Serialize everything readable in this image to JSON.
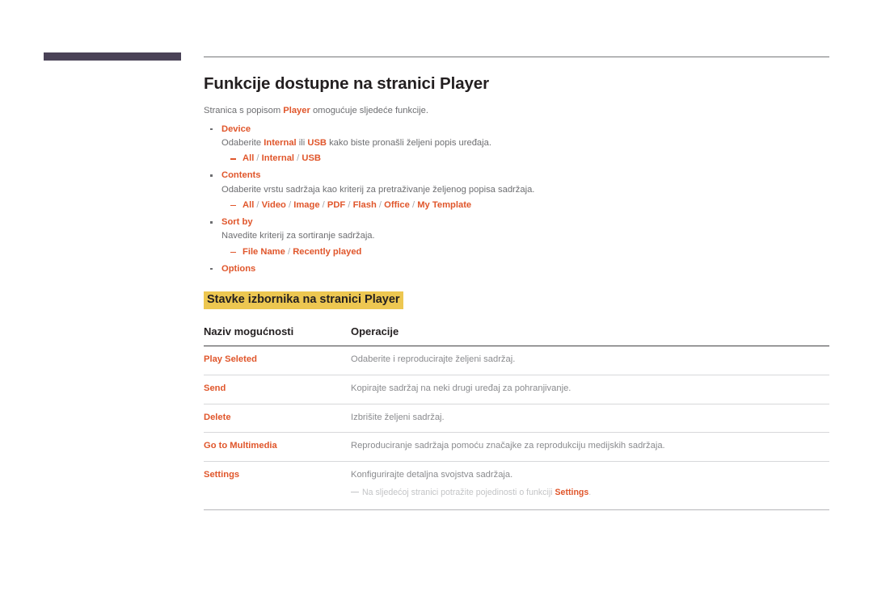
{
  "theme": {
    "accent_orange": "#e0562b",
    "highlight_yellow": "#edc751",
    "corner_bar_purple": "#4a4257",
    "body_gray": "#6d6e71",
    "title_black": "#231f20"
  },
  "header": {
    "corner_bar_label": "chapter-marker-bar",
    "rule_label": "header-rule"
  },
  "main": {
    "title": "Funkcije dostupne na stranici Player",
    "intro": {
      "before": "Stranica s popisom ",
      "keyword": "Player",
      "after": " omogućuje sljedeće funkcije."
    },
    "bullets": [
      {
        "label": "Device",
        "description_before": "Odaberite ",
        "description_kw1": "Internal",
        "description_mid": " ili ",
        "description_kw2": "USB",
        "description_after": " kako biste pronašli željeni popis uređaja.",
        "options": [
          "All",
          "Internal",
          "USB"
        ]
      },
      {
        "label": "Contents",
        "description_before": "Odaberite vrstu sadržaja kao kriterij za pretraživanje željenog popisa sadržaja.",
        "description_kw1": "",
        "description_mid": "",
        "description_kw2": "",
        "description_after": "",
        "options": [
          "All",
          "Video",
          "Image",
          "PDF",
          "Flash",
          "Office",
          "My Template"
        ]
      },
      {
        "label": "Sort by",
        "description_before": "Navedite kriterij za sortiranje sadržaja.",
        "description_kw1": "",
        "description_mid": "",
        "description_kw2": "",
        "description_after": "",
        "options": [
          "File Name",
          "Recently played"
        ]
      },
      {
        "label": "Options",
        "description_before": "",
        "description_kw1": "",
        "description_mid": "",
        "description_kw2": "",
        "description_after": "",
        "options": []
      }
    ],
    "subsection_heading": "Stavke izbornika na stranici Player",
    "table": {
      "columns": [
        "Naziv mogućnosti",
        "Operacije"
      ],
      "rows": [
        {
          "name": "Play Seleted",
          "description": "Odaberite i reproducirajte željeni sadržaj.",
          "note_before": "",
          "note_kw": "",
          "note_after": ""
        },
        {
          "name": "Send",
          "description": "Kopirajte sadržaj na neki drugi uređaj za pohranjivanje.",
          "note_before": "",
          "note_kw": "",
          "note_after": ""
        },
        {
          "name": "Delete",
          "description": "Izbrišite željeni sadržaj.",
          "note_before": "",
          "note_kw": "",
          "note_after": ""
        },
        {
          "name": "Go to Multimedia",
          "description": "Reproduciranje sadržaja pomoću značajke za reprodukciju medijskih sadržaja.",
          "note_before": "",
          "note_kw": "",
          "note_after": ""
        },
        {
          "name": "Settings",
          "description": "Konfigurirajte detaljna svojstva sadržaja.",
          "note_before": "Na sljedećoj stranici potražite pojedinosti o funkciji ",
          "note_kw": "Settings",
          "note_after": "."
        }
      ]
    }
  }
}
